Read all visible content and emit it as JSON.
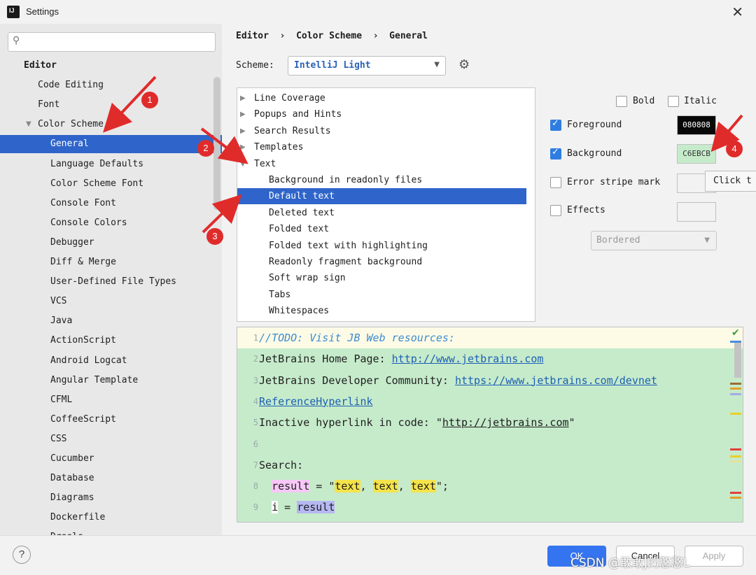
{
  "window": {
    "title": "Settings"
  },
  "sidebar": {
    "search_placeholder": "",
    "items": [
      {
        "label": "Editor",
        "level": 0,
        "bold": true
      },
      {
        "label": "Code Editing",
        "level": 1
      },
      {
        "label": "Font",
        "level": 1
      },
      {
        "label": "Color Scheme",
        "level": 1,
        "expanded": true
      },
      {
        "label": "General",
        "level": 2,
        "selected": true
      },
      {
        "label": "Language Defaults",
        "level": 2
      },
      {
        "label": "Color Scheme Font",
        "level": 2
      },
      {
        "label": "Console Font",
        "level": 2
      },
      {
        "label": "Console Colors",
        "level": 2
      },
      {
        "label": "Debugger",
        "level": 2
      },
      {
        "label": "Diff & Merge",
        "level": 2
      },
      {
        "label": "User-Defined File Types",
        "level": 2
      },
      {
        "label": "VCS",
        "level": 2
      },
      {
        "label": "Java",
        "level": 2
      },
      {
        "label": "ActionScript",
        "level": 2
      },
      {
        "label": "Android Logcat",
        "level": 2
      },
      {
        "label": "Angular Template",
        "level": 2
      },
      {
        "label": "CFML",
        "level": 2
      },
      {
        "label": "CoffeeScript",
        "level": 2
      },
      {
        "label": "CSS",
        "level": 2
      },
      {
        "label": "Cucumber",
        "level": 2
      },
      {
        "label": "Database",
        "level": 2
      },
      {
        "label": "Diagrams",
        "level": 2
      },
      {
        "label": "Dockerfile",
        "level": 2
      },
      {
        "label": "Drools",
        "level": 2
      }
    ]
  },
  "breadcrumb": {
    "part1": "Editor",
    "part2": "Color Scheme",
    "part3": "General",
    "sep": "›"
  },
  "scheme": {
    "label": "Scheme:",
    "value": "IntelliJ Light"
  },
  "attributes_list": [
    {
      "label": "Line Coverage",
      "level": 0,
      "arrow": "▶"
    },
    {
      "label": "Popups and Hints",
      "level": 0,
      "arrow": "▶"
    },
    {
      "label": "Search Results",
      "level": 0,
      "arrow": "▶"
    },
    {
      "label": "Templates",
      "level": 0,
      "arrow": "▶"
    },
    {
      "label": "Text",
      "level": 0,
      "arrow": "▼"
    },
    {
      "label": "Background in readonly files",
      "level": 1
    },
    {
      "label": "Default text",
      "level": 1,
      "selected": true
    },
    {
      "label": "Deleted text",
      "level": 1
    },
    {
      "label": "Folded text",
      "level": 1
    },
    {
      "label": "Folded text with highlighting",
      "level": 1
    },
    {
      "label": "Readonly fragment background",
      "level": 1
    },
    {
      "label": "Soft wrap sign",
      "level": 1
    },
    {
      "label": "Tabs",
      "level": 1
    },
    {
      "label": "Whitespaces",
      "level": 1
    }
  ],
  "options": {
    "bold": {
      "label": "Bold",
      "checked": false
    },
    "italic": {
      "label": "Italic",
      "checked": false
    },
    "foreground": {
      "label": "Foreground",
      "checked": true,
      "color": "080808"
    },
    "background": {
      "label": "Background",
      "checked": true,
      "color": "C6EBCB"
    },
    "error_stripe": {
      "label": "Error stripe mark",
      "checked": false
    },
    "effects": {
      "label": "Effects",
      "checked": false,
      "style": "Bordered"
    },
    "tooltip": "Click t"
  },
  "preview": {
    "lines": [
      {
        "n": "1",
        "parts": [
          {
            "t": "//TODO: Visit JB Web resources:",
            "c": "todo"
          }
        ]
      },
      {
        "n": "2",
        "parts": [
          {
            "t": "JetBrains Home Page: "
          },
          {
            "t": "http://www.jetbrains.com",
            "c": "link"
          }
        ]
      },
      {
        "n": "3",
        "parts": [
          {
            "t": "JetBrains Developer Community: "
          },
          {
            "t": "https://www.jetbrains.com/devnet",
            "c": "link"
          }
        ]
      },
      {
        "n": "4",
        "parts": [
          {
            "t": "ReferenceHyperlink",
            "c": "link"
          }
        ]
      },
      {
        "n": "5",
        "parts": [
          {
            "t": "Inactive hyperlink in code: \""
          },
          {
            "t": "http://jetbrains.com",
            "c": "inactive"
          },
          {
            "t": "\""
          }
        ]
      },
      {
        "n": "6",
        "parts": []
      },
      {
        "n": "7",
        "parts": [
          {
            "t": "Search:"
          }
        ]
      },
      {
        "n": "8",
        "parts": [
          {
            "t": "  "
          },
          {
            "t": "result",
            "c": "hl-pink"
          },
          {
            "t": " = \""
          },
          {
            "t": "text",
            "c": "hl-yel"
          },
          {
            "t": ", "
          },
          {
            "t": "text",
            "c": "hl-yel"
          },
          {
            "t": ", "
          },
          {
            "t": "text",
            "c": "hl-yel"
          },
          {
            "t": "\";"
          }
        ]
      },
      {
        "n": "9",
        "parts": [
          {
            "t": "  "
          },
          {
            "t": "i",
            "c": "hl-white"
          },
          {
            "t": " = "
          },
          {
            "t": "result",
            "c": "hl-blue"
          }
        ]
      }
    ]
  },
  "buttons": {
    "ok": "OK",
    "cancel": "Cancel",
    "apply": "Apply",
    "help": "?"
  },
  "annotations": [
    "1",
    "2",
    "3",
    "4"
  ],
  "watermark": "CSDN @敢敢J的憨憨L",
  "colors": {
    "selection": "#2f65ca",
    "link": "#1c5fb3",
    "todo": "#3d8bd1",
    "preview_bg": "#C6EBCB",
    "arrow_red": "#e02b2b"
  }
}
